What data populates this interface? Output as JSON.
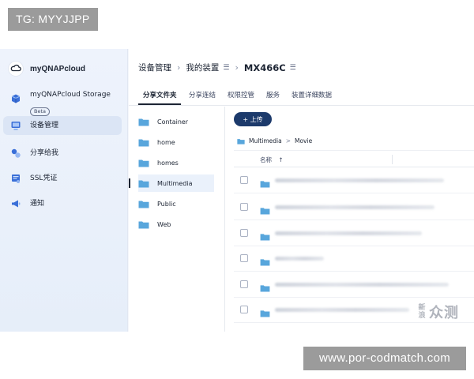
{
  "overlay": {
    "tag": "TG: MYYJJPP",
    "url": "www.por-codmatch.com",
    "site_stack": "新\n浪",
    "site_big": "众测"
  },
  "brand": {
    "name": "myQNAPcloud"
  },
  "sidebar": {
    "items": [
      {
        "label": "myQNAPcloud Storage",
        "badge": "Beta",
        "icon": "storage-icon"
      },
      {
        "label": "设备管理",
        "icon": "device-icon",
        "active": true
      },
      {
        "label": "分享给我",
        "icon": "share-icon"
      },
      {
        "label": "SSL凭证",
        "icon": "ssl-icon"
      },
      {
        "label": "通知",
        "icon": "notify-icon"
      }
    ]
  },
  "breadcrumb": {
    "root": "设备管理",
    "sep1": "›",
    "mydevices": "我的装置",
    "menu1": "☰",
    "sep2": "›",
    "device": "MX466C",
    "menu2": "☰"
  },
  "tabs": [
    {
      "label": "分享文件夹",
      "active": true
    },
    {
      "label": "分享连结"
    },
    {
      "label": "权限控管"
    },
    {
      "label": "服务"
    },
    {
      "label": "装置详细数据"
    }
  ],
  "folders": [
    {
      "name": "Container"
    },
    {
      "name": "home"
    },
    {
      "name": "homes"
    },
    {
      "name": "Multimedia",
      "active": true
    },
    {
      "name": "Public"
    },
    {
      "name": "Web"
    }
  ],
  "actions": {
    "upload": "+ 上传"
  },
  "path": {
    "parent": "Multimedia",
    "arrow": ">",
    "current": "Movie"
  },
  "list": {
    "column_name": "名称",
    "sort_indicator": "↑"
  },
  "colors": {
    "accent": "#1c3a6b",
    "folder": "#58a6dc",
    "sidebar_bg": "#eef3fc"
  }
}
